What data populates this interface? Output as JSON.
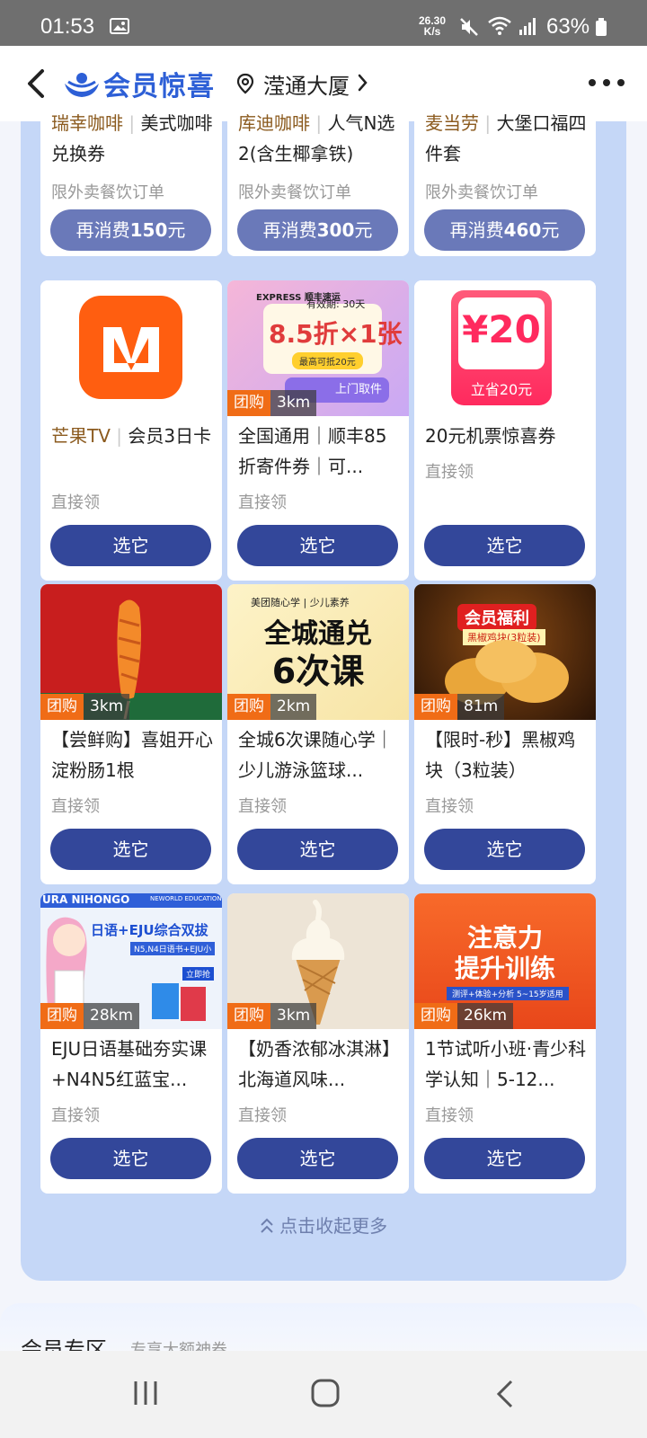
{
  "status": {
    "time": "01:53",
    "speed_top": "26.30",
    "speed_bottom": "K/s",
    "battery": "63%"
  },
  "header": {
    "title": "会员惊喜",
    "location": "滢通大厦"
  },
  "top_row": [
    {
      "title_brand": "瑞幸咖啡",
      "title_rest": "美式咖啡兑换券",
      "sub": "限外卖餐饮订单",
      "btn_prefix": "再消费",
      "btn_amount": "150",
      "btn_suffix": "元"
    },
    {
      "title_brand": "库迪咖啡",
      "title_rest": "人气N选2(含生椰拿铁)",
      "sub": "限外卖餐饮订单",
      "btn_prefix": "再消费",
      "btn_amount": "300",
      "btn_suffix": "元"
    },
    {
      "title_brand": "麦当劳",
      "title_rest": "大堡口福四件套",
      "sub": "限外卖餐饮订单",
      "btn_prefix": "再消费",
      "btn_amount": "460",
      "btn_suffix": "元"
    }
  ],
  "cards": [
    {
      "brand": "芒果TV",
      "title": "会员3日卡",
      "sub": "直接领",
      "btn": "选它"
    },
    {
      "title": "全国通用｜顺丰85折寄件券｜可...",
      "sub": "直接领",
      "btn": "选它",
      "tag": "团购",
      "dist": "3km",
      "img": {
        "brand": "EXPRESS 顺丰速运",
        "validity": "有效期: 30天",
        "discount": "8.5折×1张",
        "cap": "最高可抵20元",
        "pickup": "上门取件"
      }
    },
    {
      "title": "20元机票惊喜券",
      "sub": "直接领",
      "btn": "选它",
      "img": {
        "amount": "¥20",
        "save": "立省20元"
      }
    },
    {
      "title": "【尝鲜购】喜姐开心淀粉肠1根",
      "sub": "直接领",
      "btn": "选它",
      "tag": "团购",
      "dist": "3km"
    },
    {
      "title": "全城6次课随心学｜少儿游泳篮球...",
      "sub": "直接领",
      "btn": "选它",
      "tag": "团购",
      "dist": "2km",
      "img": {
        "header": "美团随心学 | 少儿素养",
        "line1": "全城通兑",
        "line2": "6次课"
      }
    },
    {
      "title": "【限时-秒】黑椒鸡块（3粒装）",
      "sub": "直接领",
      "btn": "选它",
      "tag": "团购",
      "dist": "81m",
      "img": {
        "badge": "会员福利",
        "badge2": "黑椒鸡块(3粒装)"
      }
    },
    {
      "title": "EJU日语基础夯实课+N4N5红蓝宝...",
      "sub": "直接领",
      "btn": "选它",
      "tag": "团购",
      "dist": "28km",
      "img": {
        "top": "URA NIHONGO",
        "edu": "NEWORLD EDUCATION",
        "headline": "日语+EJU综合双拔",
        "sub": "N5,N4日语书+EJU小",
        "go": "立即抢"
      }
    },
    {
      "title": "【奶香浓郁冰淇淋】北海道风味...",
      "sub": "直接领",
      "btn": "选它",
      "tag": "团购",
      "dist": "3km"
    },
    {
      "title": "1节试听小班·青少科学认知｜5-12...",
      "sub": "直接领",
      "btn": "选它",
      "tag": "团购",
      "dist": "26km",
      "img": {
        "line1": "注意力",
        "line2": "提升训练",
        "sub": "测评+体验+分析  5~15岁适用"
      }
    }
  ],
  "collapse": "点击收起更多",
  "section": {
    "title": "会员专区",
    "sub": "专享大额神券"
  }
}
